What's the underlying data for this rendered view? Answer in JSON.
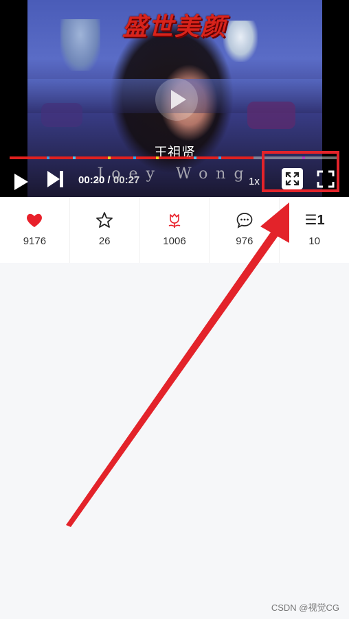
{
  "player": {
    "video_title_overlay": "盛世美颜",
    "subtitle_cn": "王祖贤",
    "subtitle_en": "Joey Wong",
    "progress_fraction": 0.74,
    "current_time": "00:20",
    "time_separator": " / ",
    "total_time": "00:27",
    "speed_label": "1x",
    "icons": [
      "play-icon",
      "next-icon",
      "web-fullscreen-icon",
      "fullscreen-icon",
      "play-overlay-icon"
    ]
  },
  "actions": [
    {
      "name": "like",
      "icon": "heart-icon",
      "count": "9176",
      "color": "#e8202a"
    },
    {
      "name": "favorite",
      "icon": "star-icon",
      "count": "26",
      "color": "#222222"
    },
    {
      "name": "gift",
      "icon": "flower-icon",
      "count": "1006",
      "color": "#e8202a"
    },
    {
      "name": "comment",
      "icon": "comment-icon",
      "count": "976",
      "color": "#222222"
    },
    {
      "name": "playlist",
      "icon": "list-icon",
      "icon_text": "☰1",
      "count": "10",
      "color": "#222222"
    }
  ],
  "annotation": {
    "color": "#e3232a"
  },
  "watermark": "CSDN @视觉CG"
}
